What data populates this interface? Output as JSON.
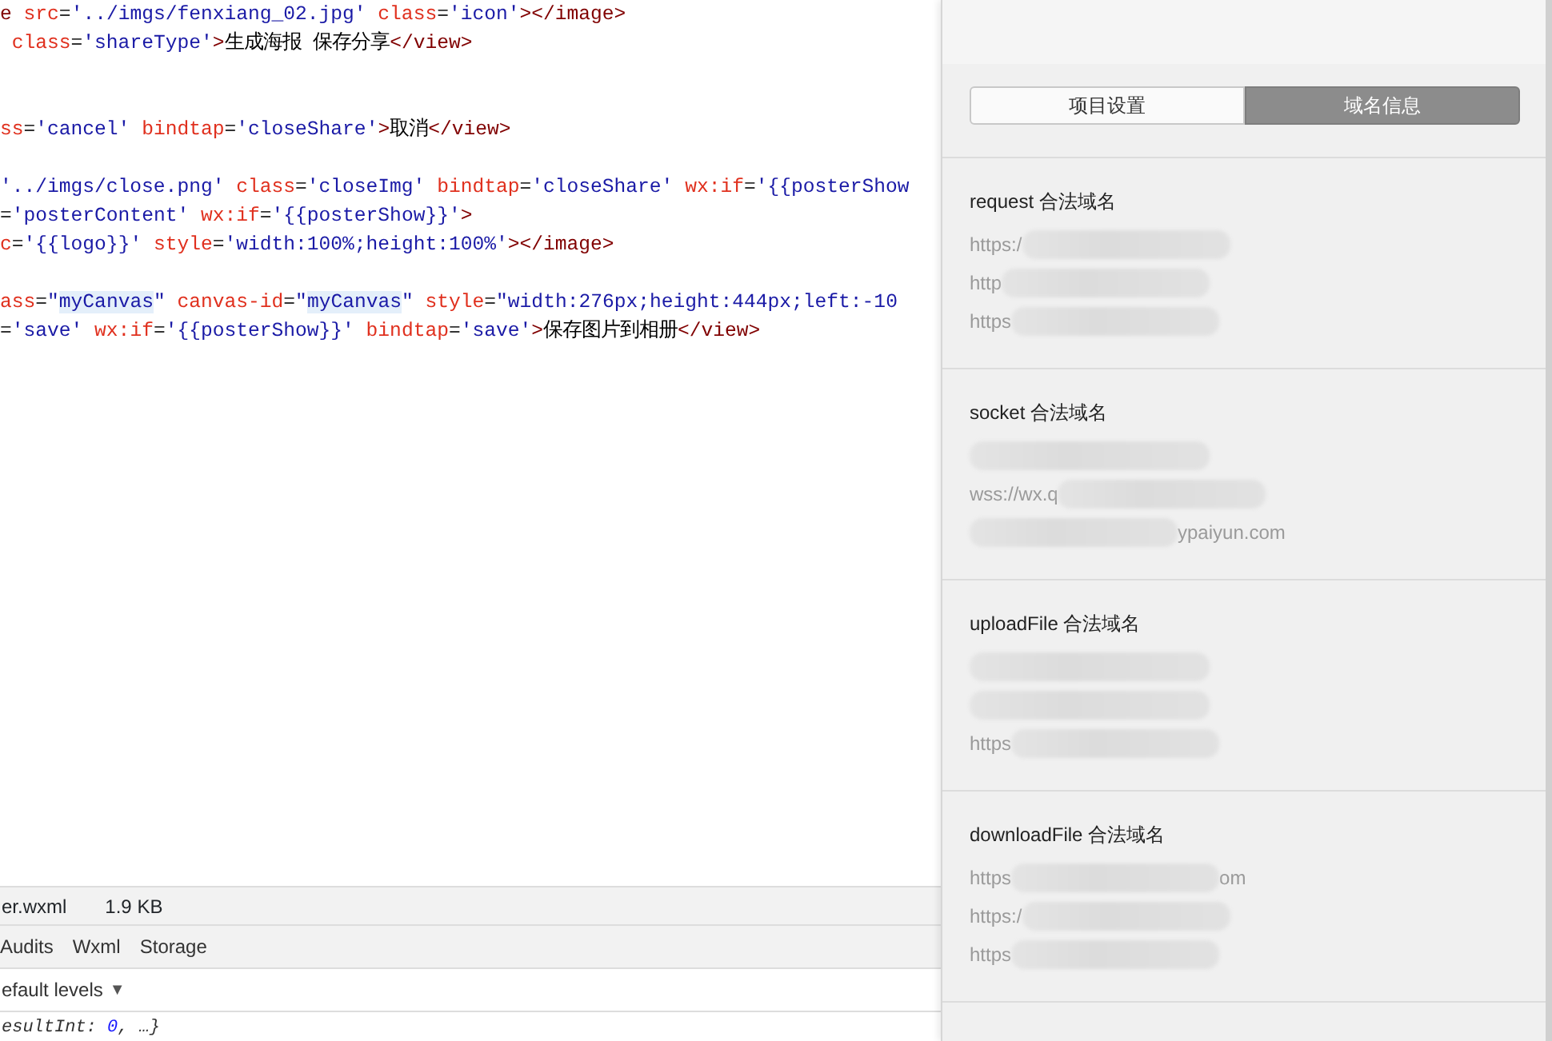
{
  "editor": {
    "lines": [
      {
        "kind": "code",
        "tokens": [
          {
            "kind": "tag",
            "text": "e"
          },
          {
            "kind": "attr",
            "text": " src"
          },
          {
            "kind": "punct",
            "text": "="
          },
          {
            "kind": "value",
            "text": "'../imgs/fenxiang_02.jpg'"
          },
          {
            "kind": "attr",
            "text": " class"
          },
          {
            "kind": "punct",
            "text": "="
          },
          {
            "kind": "value",
            "text": "'icon'"
          },
          {
            "kind": "tag",
            "text": "></image>"
          }
        ]
      },
      {
        "kind": "code",
        "tokens": [
          {
            "kind": "attr",
            "text": " class"
          },
          {
            "kind": "punct",
            "text": "="
          },
          {
            "kind": "value",
            "text": "'shareType'"
          },
          {
            "kind": "tag",
            "text": ">"
          },
          {
            "kind": "text",
            "text": "生成海报 保存分享"
          },
          {
            "kind": "tag",
            "text": "</view>"
          }
        ]
      },
      {
        "kind": "blank"
      },
      {
        "kind": "blank"
      },
      {
        "kind": "code",
        "tokens": [
          {
            "kind": "attr",
            "text": "ss"
          },
          {
            "kind": "punct",
            "text": "="
          },
          {
            "kind": "value",
            "text": "'cancel'"
          },
          {
            "kind": "attr",
            "text": " bindtap"
          },
          {
            "kind": "punct",
            "text": "="
          },
          {
            "kind": "value",
            "text": "'closeShare'"
          },
          {
            "kind": "tag",
            "text": ">"
          },
          {
            "kind": "text",
            "text": "取消"
          },
          {
            "kind": "tag",
            "text": "</view>"
          }
        ]
      },
      {
        "kind": "blank"
      },
      {
        "kind": "code",
        "tokens": [
          {
            "kind": "value",
            "text": "'../imgs/close.png'"
          },
          {
            "kind": "attr",
            "text": " class"
          },
          {
            "kind": "punct",
            "text": "="
          },
          {
            "kind": "value",
            "text": "'closeImg'"
          },
          {
            "kind": "attr",
            "text": " bindtap"
          },
          {
            "kind": "punct",
            "text": "="
          },
          {
            "kind": "value",
            "text": "'closeShare'"
          },
          {
            "kind": "attr",
            "text": " wx:if"
          },
          {
            "kind": "punct",
            "text": "="
          },
          {
            "kind": "value",
            "text": "'{{posterShow"
          }
        ]
      },
      {
        "kind": "code",
        "tokens": [
          {
            "kind": "punct",
            "text": "="
          },
          {
            "kind": "value",
            "text": "'posterContent'"
          },
          {
            "kind": "attr",
            "text": " wx:if"
          },
          {
            "kind": "punct",
            "text": "="
          },
          {
            "kind": "value",
            "text": "'{{posterShow}}'"
          },
          {
            "kind": "tag",
            "text": ">"
          }
        ]
      },
      {
        "kind": "code",
        "tokens": [
          {
            "kind": "attr",
            "text": "c"
          },
          {
            "kind": "punct",
            "text": "="
          },
          {
            "kind": "value",
            "text": "'{{logo}}'"
          },
          {
            "kind": "attr",
            "text": " style"
          },
          {
            "kind": "punct",
            "text": "="
          },
          {
            "kind": "value",
            "text": "'width:100%;height:100%'"
          },
          {
            "kind": "tag",
            "text": "></image>"
          }
        ]
      },
      {
        "kind": "blank"
      },
      {
        "kind": "code",
        "tokens": [
          {
            "kind": "attr",
            "text": "ass"
          },
          {
            "kind": "punct",
            "text": "="
          },
          {
            "kind": "value",
            "text": "\""
          },
          {
            "kind": "highlight",
            "text": "myCanvas"
          },
          {
            "kind": "value",
            "text": "\""
          },
          {
            "kind": "attr",
            "text": " canvas-id"
          },
          {
            "kind": "punct",
            "text": "="
          },
          {
            "kind": "value",
            "text": "\""
          },
          {
            "kind": "highlight",
            "text": "myCanvas"
          },
          {
            "kind": "value",
            "text": "\""
          },
          {
            "kind": "attr",
            "text": " style"
          },
          {
            "kind": "punct",
            "text": "="
          },
          {
            "kind": "value",
            "text": "\"width:276px;height:444px;left:-10"
          }
        ]
      },
      {
        "kind": "code",
        "tokens": [
          {
            "kind": "punct",
            "text": "="
          },
          {
            "kind": "value",
            "text": "'save'"
          },
          {
            "kind": "attr",
            "text": " wx:if"
          },
          {
            "kind": "punct",
            "text": "="
          },
          {
            "kind": "value",
            "text": "'{{posterShow}}'"
          },
          {
            "kind": "attr",
            "text": " bindtap"
          },
          {
            "kind": "punct",
            "text": "="
          },
          {
            "kind": "value",
            "text": "'save'"
          },
          {
            "kind": "tag",
            "text": ">"
          },
          {
            "kind": "text",
            "text": "保存图片到相册"
          },
          {
            "kind": "tag",
            "text": "</view>"
          }
        ]
      }
    ]
  },
  "file_bar": {
    "filename": "er.wxml",
    "size": "1.9 KB"
  },
  "devtools_tabs": [
    {
      "label": "Audits",
      "selected": false
    },
    {
      "label": "Wxml",
      "selected": false
    },
    {
      "label": "Storage",
      "selected": false
    }
  ],
  "console_filter": {
    "label": "efault levels",
    "caret": "▼"
  },
  "console_output": {
    "prefix": "esultInt: ",
    "number": "0",
    "suffix": ", …}"
  },
  "details_panel": {
    "segments": [
      {
        "label": "项目设置",
        "selected": false
      },
      {
        "label": "域名信息",
        "selected": true
      }
    ],
    "sections": [
      {
        "title": "request 合法域名",
        "urls": [
          {
            "kind": "partial",
            "text": "https:/"
          },
          {
            "kind": "partial",
            "text": "http"
          },
          {
            "kind": "partial",
            "text": "https"
          }
        ]
      },
      {
        "title": "socket 合法域名",
        "urls": [
          {
            "kind": "hidden"
          },
          {
            "kind": "partial",
            "text": "wss://wx.q"
          },
          {
            "kind": "tail",
            "text": "ypaiyun.com"
          }
        ]
      },
      {
        "title": "uploadFile 合法域名",
        "urls": [
          {
            "kind": "hidden"
          },
          {
            "kind": "hidden"
          },
          {
            "kind": "partial",
            "text": "https"
          }
        ]
      },
      {
        "title": "downloadFile 合法域名",
        "urls": [
          {
            "kind": "tail",
            "text": "https",
            "tail": "om"
          },
          {
            "kind": "partial",
            "text": "https:/"
          },
          {
            "kind": "partial",
            "text": "https"
          }
        ]
      }
    ]
  }
}
